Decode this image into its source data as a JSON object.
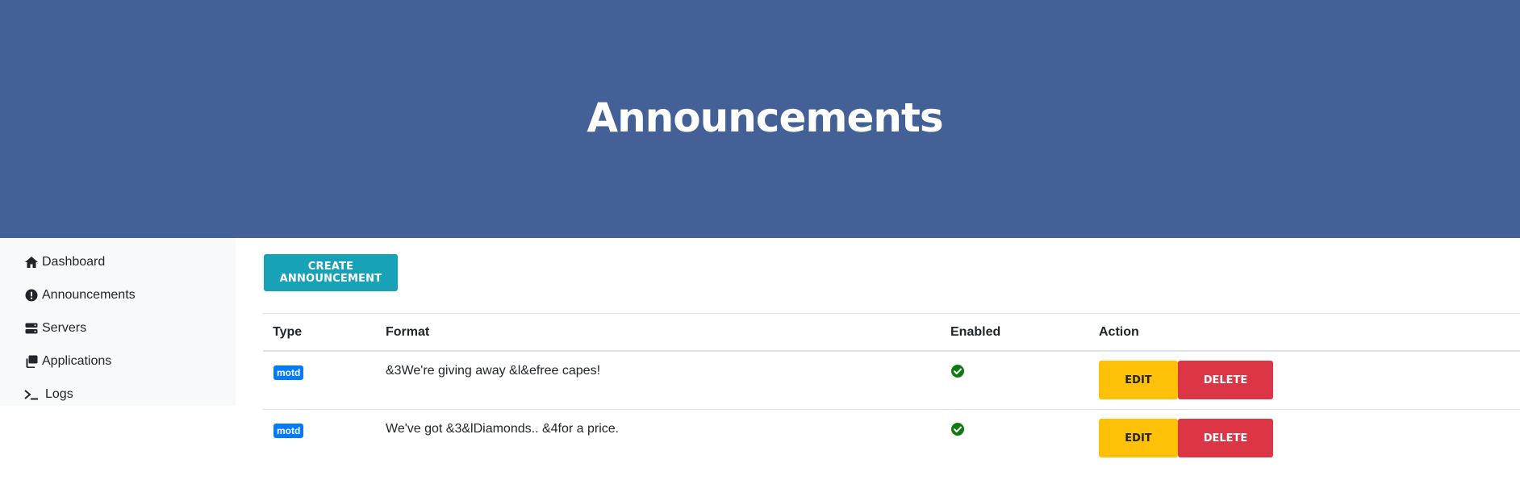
{
  "header": {
    "title": "Announcements"
  },
  "sidebar": {
    "items": [
      {
        "label": "Dashboard",
        "icon": "home-icon"
      },
      {
        "label": "Announcements",
        "icon": "exclamation-circle-icon"
      },
      {
        "label": "Servers",
        "icon": "server-icon"
      },
      {
        "label": "Applications",
        "icon": "windows-icon"
      },
      {
        "label": "Logs",
        "icon": "terminal-icon"
      }
    ]
  },
  "main": {
    "create_label": "Create Announcement",
    "table": {
      "headers": {
        "type": "Type",
        "format": "Format",
        "enabled": "Enabled",
        "action": "Action"
      },
      "rows": [
        {
          "type": "motd",
          "format": "&3We're giving away &l&efree capes!",
          "enabled": true,
          "edit_label": "Edit",
          "delete_label": "Delete"
        },
        {
          "type": "motd",
          "format": "We've got &3&lDiamonds.. &4for a price.",
          "enabled": true,
          "edit_label": "Edit",
          "delete_label": "Delete"
        }
      ]
    }
  },
  "colors": {
    "hero": "#436196",
    "create_button": "#17a2b8",
    "badge": "#007bff",
    "edit_button": "#ffc107",
    "delete_button": "#dc3545",
    "check": "#0f7a12"
  }
}
